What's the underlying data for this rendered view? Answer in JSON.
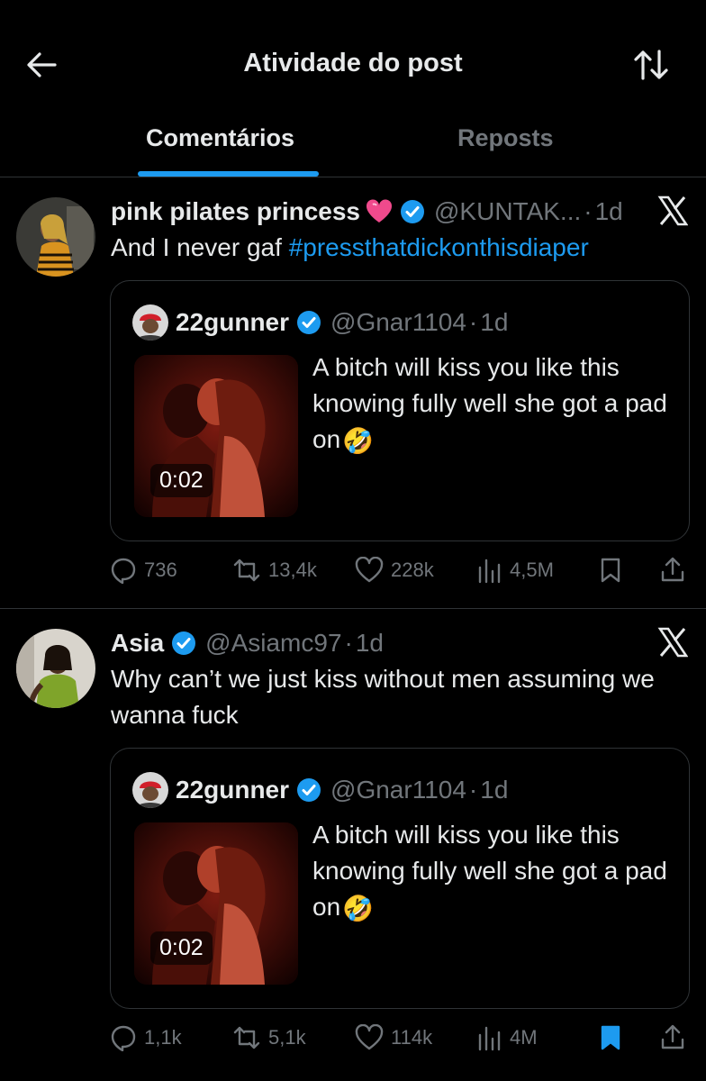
{
  "header": {
    "title": "Atividade do post",
    "back_icon": "back-arrow-icon",
    "sort_icon": "sort-arrows-icon"
  },
  "tabs": [
    {
      "label": "Comentários",
      "active": true
    },
    {
      "label": "Reposts",
      "active": false
    }
  ],
  "colors": {
    "accent": "#1d9bf0",
    "muted": "#71767b",
    "text": "#e7e9ea",
    "background": "#000000",
    "heart": "#f04a8c"
  },
  "tweets": [
    {
      "name": "pink pilates princess",
      "name_emoji": "💗",
      "verified": true,
      "handle": "@KUNTAK...",
      "dot": "·",
      "time": "1d",
      "text_prefix": "And I never gaf ",
      "hashtag": "#pressthatdickonthisdiaper",
      "quote": {
        "name": "22gunner",
        "verified": true,
        "handle": "@Gnar1104",
        "dot": "·",
        "time": "1d",
        "text": "A bitch will kiss you like this knowing fully well she got a pad on",
        "text_emoji": "🤣",
        "video_duration": "0:02"
      },
      "actions": {
        "replies": "736",
        "reposts": "13,4k",
        "likes": "228k",
        "views": "4,5M",
        "bookmarked": false
      }
    },
    {
      "name": "Asia",
      "verified": true,
      "handle": "@Asiamc97",
      "dot": "·",
      "time": "1d",
      "text": "Why can’t we just kiss without men assuming we wanna fuck",
      "quote": {
        "name": "22gunner",
        "verified": true,
        "handle": "@Gnar1104",
        "dot": "·",
        "time": "1d",
        "text": "A bitch will kiss you like this knowing fully well she got a pad on",
        "text_emoji": "🤣",
        "video_duration": "0:02"
      },
      "actions": {
        "replies": "1,1k",
        "reposts": "5,1k",
        "likes": "114k",
        "views": "4M",
        "bookmarked": true
      }
    }
  ]
}
